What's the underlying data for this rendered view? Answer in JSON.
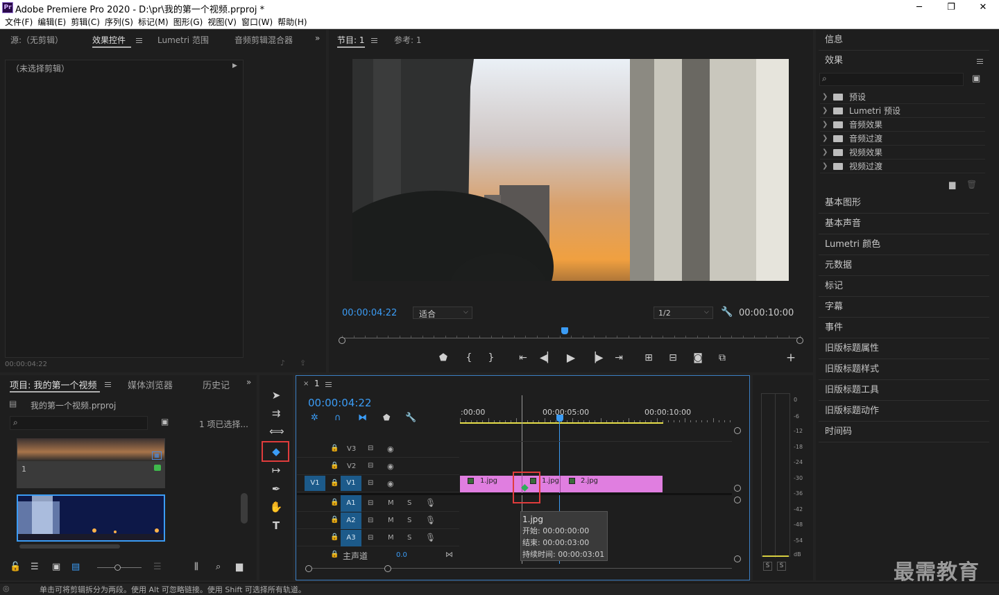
{
  "titlebar": {
    "title": "Adobe Premiere Pro 2020 - D:\\pr\\我的第一个视频.prproj *",
    "app_logo": "Pr",
    "minimize": "─",
    "restore": "❐",
    "close": "✕"
  },
  "menu": [
    "文件(F)",
    "编辑(E)",
    "剪辑(C)",
    "序列(S)",
    "标记(M)",
    "图形(G)",
    "视图(V)",
    "窗口(W)",
    "帮助(H)"
  ],
  "source_panel": {
    "tabs": [
      "源:（无剪辑）",
      "效果控件",
      "Lumetri 范围",
      "音频剪辑混合器"
    ],
    "active_tab": "效果控件",
    "no_clip": "（未选择剪辑）",
    "timecode": "00:00:04:22"
  },
  "program_monitor": {
    "tabs": [
      "节目: 1",
      "参考: 1"
    ],
    "timecode": "00:00:04:22",
    "fit": "适合",
    "resolution": "1/2",
    "duration": "00:00:10:00",
    "playhead_fraction": 0.487
  },
  "right_panel": {
    "info": "信息",
    "effects": "效果",
    "tree": [
      "预设",
      "Lumetri 预设",
      "音频效果",
      "音频过渡",
      "视频效果",
      "视频过渡"
    ],
    "sections": [
      "基本图形",
      "基本声音",
      "Lumetri 颜色",
      "元数据",
      "标记",
      "字幕",
      "事件",
      "旧版标题属性",
      "旧版标题样式",
      "旧版标题工具",
      "旧版标题动作",
      "时间码"
    ]
  },
  "project_panel": {
    "tabs": [
      "项目: 我的第一个视频",
      "媒体浏览器",
      "历史记"
    ],
    "file": "我的第一个视频.prproj",
    "selection": "1 项已选择...",
    "item_label": "1"
  },
  "timeline": {
    "tab": "1",
    "timecode": "00:00:04:22",
    "ruler": [
      ":00:00",
      "00:00:05:00",
      "00:00:10:00"
    ],
    "video_tracks": [
      "V3",
      "V2",
      "V1"
    ],
    "audio_tracks": [
      "A1",
      "A2",
      "A3"
    ],
    "source_patch": "V1",
    "master": "主声道",
    "master_value": "0.0",
    "mute": "M",
    "solo": "S",
    "clips": [
      "1.jpg",
      "1.jpg",
      "2.jpg"
    ],
    "clip_color": "#e07ee0",
    "tooltip": {
      "name": "1.jpg",
      "start": "开始: 00:00:00:00",
      "end": "结束: 00:00:03:00",
      "duration": "持续时间: 00:00:03:01"
    }
  },
  "meter": {
    "scale": [
      "0",
      "-6",
      "-12",
      "-18",
      "-24",
      "-30",
      "-36",
      "-42",
      "-48",
      "-54",
      "dB"
    ],
    "solo_left": "S",
    "solo_right": "S"
  },
  "statusbar": {
    "text": "单击可将剪辑拆分为两段。使用 Alt 可忽略链接。使用 Shift 可选择所有轨道。"
  },
  "watermark": "最需教育",
  "accent": "#3b9cf5"
}
